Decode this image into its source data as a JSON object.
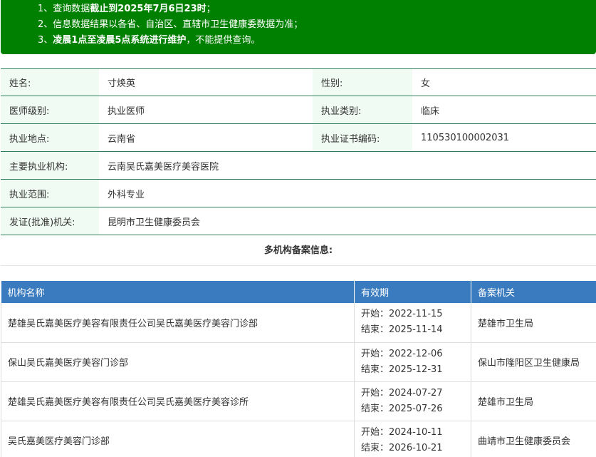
{
  "notice": {
    "line1": {
      "prefix": "1、查询数据",
      "bold": "截止到2025年7月6日23时",
      "suffix": "；"
    },
    "line2": {
      "text": "2、信息数据结果以各省、自治区、直辖市卫生健康委数据为准；"
    },
    "line3": {
      "prefix": "3、",
      "bold": "凌晨1点至凌晨5点系统进行维护",
      "suffix": "，不能提供查询。"
    }
  },
  "doctor": {
    "name_label": "姓名:",
    "name": "寸焕英",
    "gender_label": "性别:",
    "gender": "女",
    "level_label": "医师级别:",
    "level": "执业医师",
    "category_label": "执业类别:",
    "category": "临床",
    "location_label": "执业地点:",
    "location": "云南省",
    "cert_label": "执业证书编码:",
    "cert": "110530100002031",
    "institution_label": "主要执业机构:",
    "institution": "云南吴氏嘉美医疗美容医院",
    "scope_label": "执业范围:",
    "scope": "外科专业",
    "authority_label": "发证(批准)机关:",
    "authority": "昆明市卫生健康委员会"
  },
  "multi_title": "多机构备案信息:",
  "records": {
    "headers": {
      "org": "机构名称",
      "validity": "有效期",
      "authority": "备案机关"
    },
    "rows": [
      {
        "org": "楚雄吴氏嘉美医疗美容有限责任公司吴氏嘉美医疗美容门诊部",
        "start": "开始：2022-11-15",
        "end": "结束：2025-11-14",
        "authority": "楚雄市卫生局"
      },
      {
        "org": "保山吴氏嘉美医疗美容门诊部",
        "start": "开始：2022-12-06",
        "end": "结束：2025-12-31",
        "authority": "保山市隆阳区卫生健康局"
      },
      {
        "org": "楚雄吴氏嘉美医疗美容有限责任公司吴氏嘉美医疗美容诊所",
        "start": "开始：2024-07-27",
        "end": "结束：2025-07-26",
        "authority": "楚雄市卫生局"
      },
      {
        "org": "吴氏嘉美医疗美容门诊部",
        "start": "开始：2024-10-11",
        "end": "结束：2026-10-21",
        "authority": "曲靖市卫生健康委员会"
      }
    ]
  }
}
